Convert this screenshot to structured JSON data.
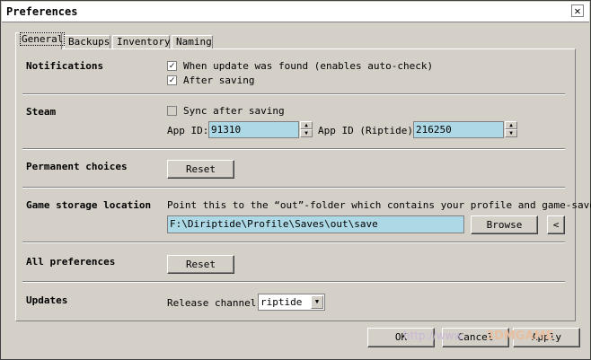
{
  "window": {
    "title": "Preferences"
  },
  "tabs": [
    {
      "label": "General",
      "active": true
    },
    {
      "label": "Backups",
      "active": false
    },
    {
      "label": "Inventory",
      "active": false
    },
    {
      "label": "Naming",
      "active": false
    }
  ],
  "notifications": {
    "label": "Notifications",
    "when_update_found": {
      "label": "When update was found (enables auto-check)",
      "checked": true
    },
    "after_saving": {
      "label": "After saving",
      "checked": true
    }
  },
  "steam": {
    "label": "Steam",
    "sync_after_saving": {
      "label": "Sync after saving",
      "checked": false,
      "enabled": false
    },
    "app_id_label": "App ID:",
    "app_id_value": "91310",
    "app_id_riptide_label": "App ID (Riptide):",
    "app_id_riptide_value": "216250"
  },
  "permanent_choices": {
    "label": "Permanent choices",
    "reset_label": "Reset"
  },
  "game_storage": {
    "label": "Game storage location",
    "hint": "Point this to the “out”-folder which contains your profile and game-saves.",
    "path": "F:\\Diriptide\\Profile\\Saves\\out\\save",
    "browse_label": "Browse",
    "back_label": "<"
  },
  "all_preferences": {
    "label": "All preferences",
    "reset_label": "Reset"
  },
  "updates": {
    "label": "Updates",
    "release_channel_label": "Release channel:",
    "release_channel_value": "riptide"
  },
  "footer": {
    "ok_label": "OK",
    "cancel_label": "Cancel",
    "apply_label": "Apply"
  },
  "watermark": {
    "text": "http://www.",
    "logo": "3DMGAME"
  },
  "icons": {
    "close": "close-icon",
    "check": "check-icon",
    "spin_up": "arrow-up-icon",
    "spin_down": "arrow-down-icon",
    "dropdown": "chevron-down-icon"
  }
}
